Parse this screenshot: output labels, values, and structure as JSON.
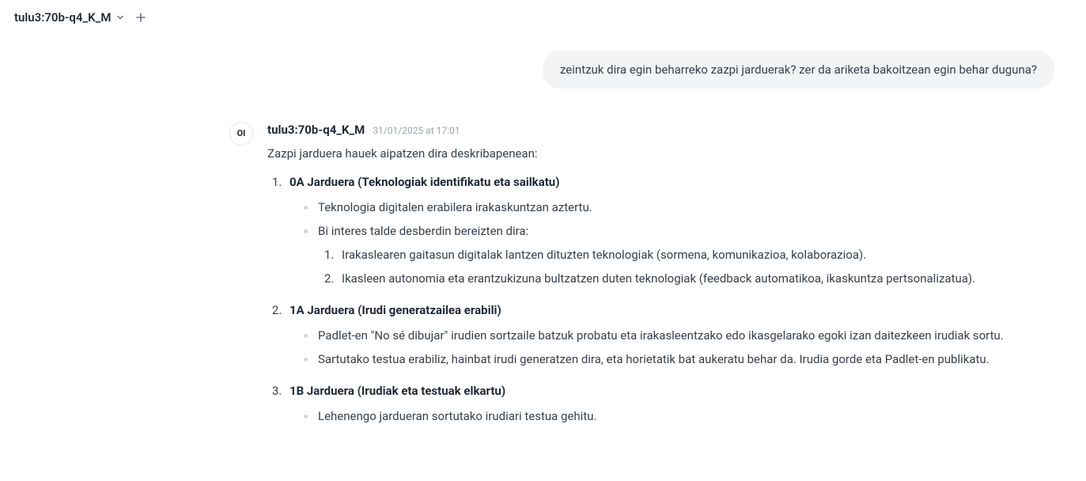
{
  "header": {
    "model_name": "tulu3:70b-q4_K_M"
  },
  "user_message": {
    "text": "zeintzuk dira egin beharreko zazpi jarduerak? zer da ariketa bakoitzean egin behar duguna?"
  },
  "assistant": {
    "avatar": "OI",
    "name": "tulu3:70b-q4_K_M",
    "timestamp": "31/01/2025 at 17:01",
    "intro": "Zazpi jarduera hauek aipatzen dira deskribapenean:",
    "activities": [
      {
        "title": "0A Jarduera (Teknologiak identifikatu eta sailkatu)",
        "bullets": [
          "Teknologia digitalen erabilera irakaskuntzan aztertu.",
          "Bi interes talde desberdin bereizten dira:"
        ],
        "nested": [
          "Irakaslearen gaitasun digitalak lantzen dituzten teknologiak (sormena, komunikazioa, kolaborazioa).",
          "Ikasleen autonomia eta erantzukizuna bultzatzen duten teknologiak (feedback automatikoa, ikaskuntza pertsonalizatua)."
        ]
      },
      {
        "title": "1A Jarduera (Irudi generatzailea erabili)",
        "bullets": [
          "Padlet-en \"No sé dibujar\" irudien sortzaile batzuk probatu eta irakasleentzako edo ikasgelarako egoki izan daitezkeen irudiak sortu.",
          "Sartutako testua erabiliz, hainbat irudi generatzen dira, eta horietatik bat aukeratu behar da. Irudia gorde eta Padlet-en publikatu."
        ],
        "nested": []
      },
      {
        "title": "1B Jarduera (Irudiak eta testuak elkartu)",
        "bullets": [
          "Lehenengo jardueran sortutako irudiari testua gehitu."
        ],
        "nested": []
      }
    ]
  }
}
